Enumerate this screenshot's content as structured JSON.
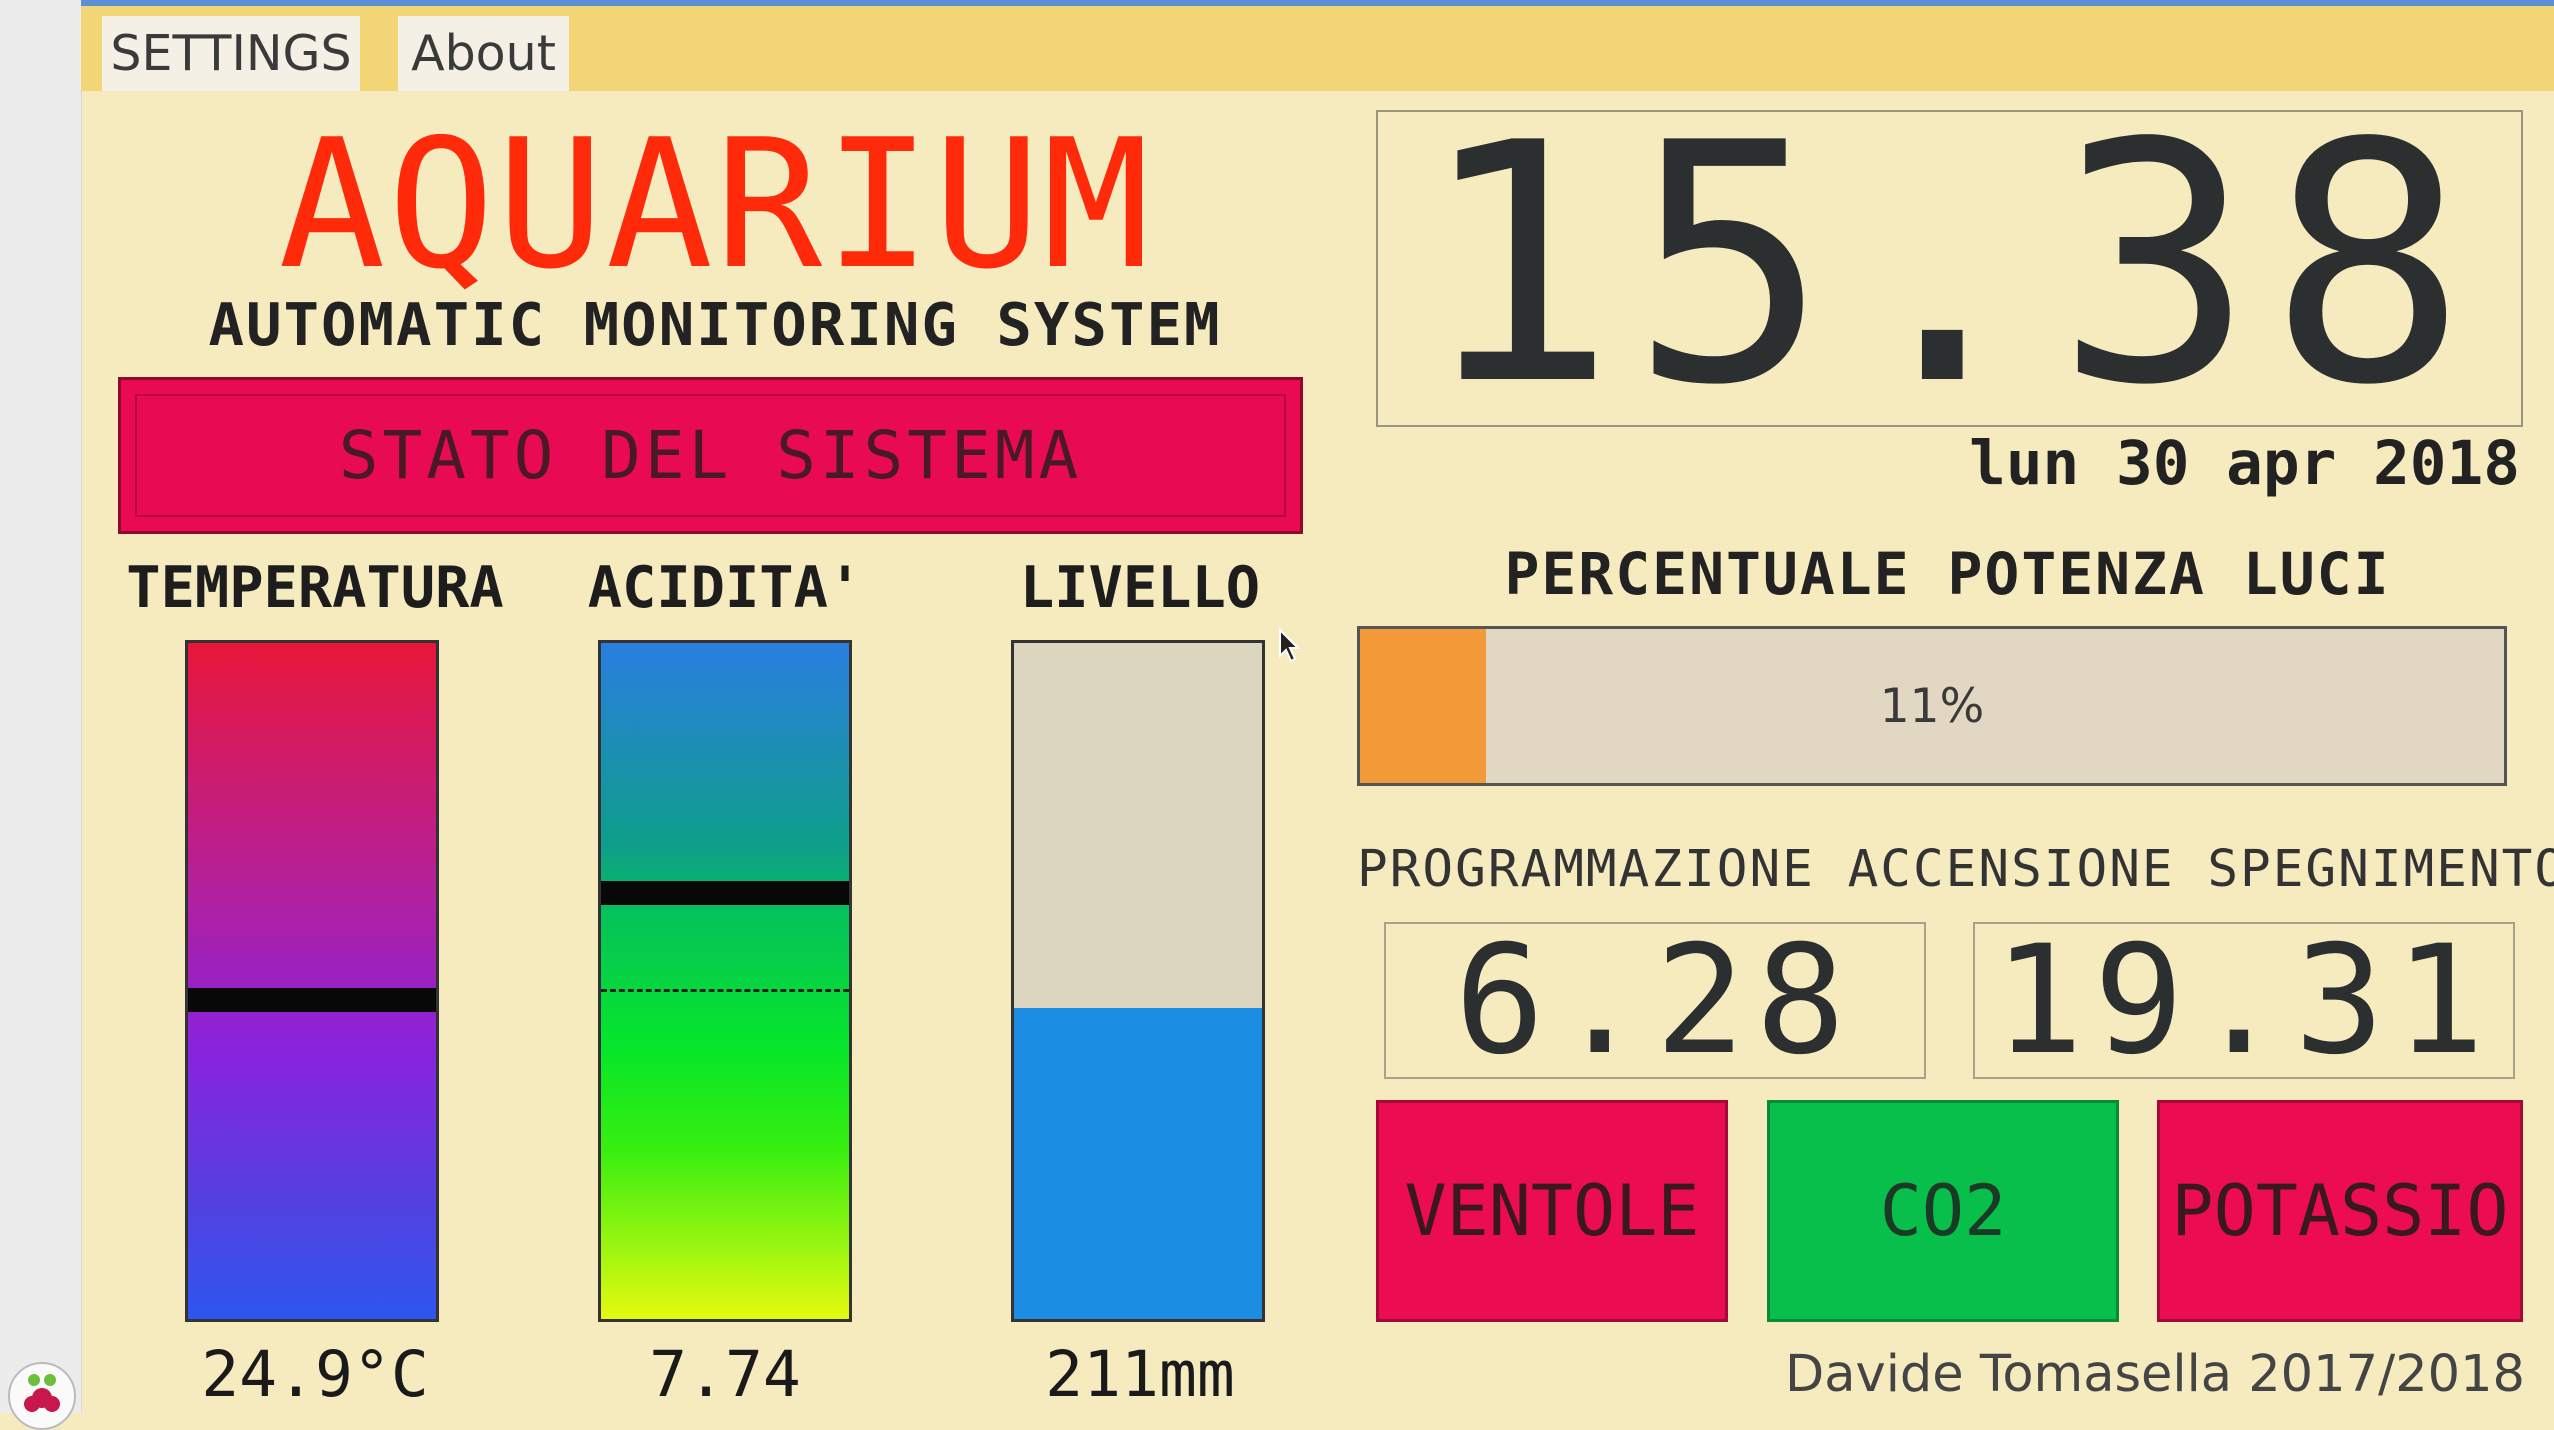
{
  "menu": {
    "settings_label": "SETTINGS",
    "about_label": "About"
  },
  "header": {
    "title": "AQUARIUM",
    "subtitle": "AUTOMATIC MONITORING SYSTEM"
  },
  "status": {
    "label": "STATO DEL SISTEMA",
    "color": "#e80a52"
  },
  "gauges": {
    "temperature": {
      "label": "TEMPERATURA",
      "value": "24.9°C"
    },
    "acidity": {
      "label": "ACIDITA'",
      "value": "7.74"
    },
    "level": {
      "label": "LIVELLO",
      "value": "211mm",
      "fill_fraction": 0.46
    }
  },
  "clock": {
    "time": "15.38",
    "date": "lun 30 apr 2018"
  },
  "lights": {
    "label": "PERCENTUALE POTENZA LUCI",
    "percent_text": "11%",
    "percent": 11
  },
  "schedule": {
    "label": "PROGRAMMAZIONE ACCENSIONE SPEGNIMENTO",
    "on_time": "6.28",
    "off_time": "19.31"
  },
  "controls": {
    "fans": "VENTOLE",
    "co2": "CO2",
    "potassium": "POTASSIO"
  },
  "footer": {
    "credit": "Davide Tomasella 2017/2018"
  },
  "colors": {
    "background": "#f5ebbf",
    "menubar": "#f2d676",
    "title": "#ff2a0a",
    "alert": "#eb0c52",
    "ok": "#08bf4c",
    "water": "#1b8ee3",
    "lights": "#f39a38"
  }
}
